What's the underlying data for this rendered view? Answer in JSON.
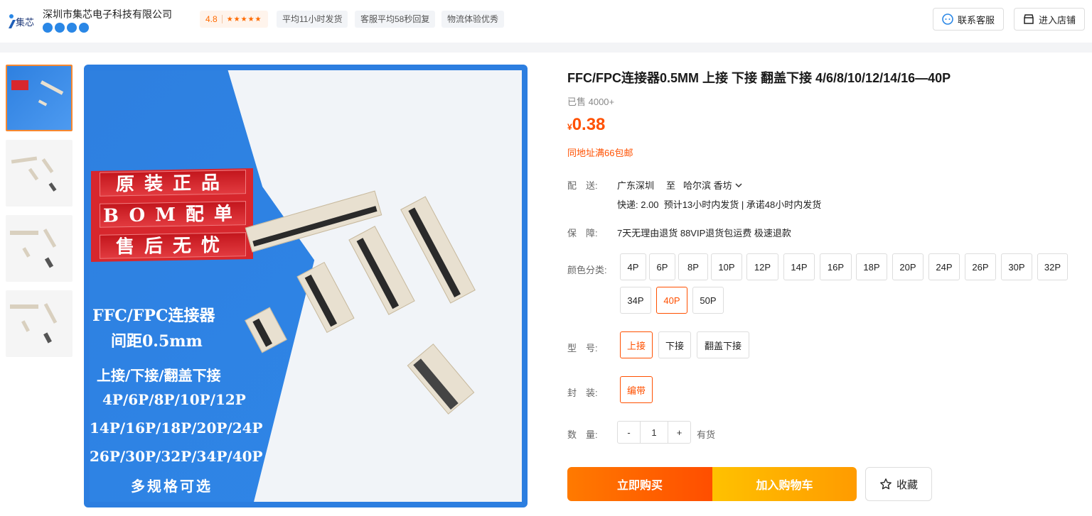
{
  "header": {
    "shop_name": "深圳市集芯电子科技有限公司",
    "logo_text": "集芯",
    "score": "4.8",
    "stars": "★★★★★",
    "tags": [
      "平均11小时发货",
      "客服平均58秒回复",
      "物流体验优秀"
    ],
    "contact_btn": "联系客服",
    "enter_shop_btn": "进入店铺",
    "accent_color": "#ff5000"
  },
  "gallery": {
    "thumb_count": 4,
    "main_image": {
      "red_lines": [
        "原装正品",
        "BOM配单",
        "售后无忧"
      ],
      "line1": "FFC/FPC连接器",
      "line2": "间距0.5mm",
      "line3": "上接/下接/翻盖下接",
      "line4": "4P/6P/8P/10P/12P",
      "line5": "14P/16P/18P/20P/24P",
      "line6": "26P/30P/32P/34P/40P",
      "line7": "多规格可选"
    }
  },
  "product": {
    "title": "FFC/FPC连接器0.5MM 上接 下接 翻盖下接 4/6/8/10/12/14/16—40P",
    "sold": "已售 4000+",
    "currency": "¥",
    "price": "0.38",
    "free_ship": "同地址满66包邮",
    "shipping": {
      "label": "配　送:",
      "from": "广东深圳",
      "to_word": "至",
      "to": "哈尔滨 香坊",
      "detail": "快递: 2.00  预计13小时内发货 | 承诺48小时内发货"
    },
    "guarantee": {
      "label": "保　障:",
      "value": "7天无理由退货 88VIP退货包运费 极速退款"
    },
    "color": {
      "label": "颜色分类:",
      "options": [
        "4P",
        "6P",
        "8P",
        "10P",
        "12P",
        "14P",
        "16P",
        "18P",
        "20P",
        "24P",
        "26P",
        "30P",
        "32P",
        "34P",
        "40P",
        "50P"
      ],
      "selected": "40P"
    },
    "model": {
      "label": "型　号:",
      "options": [
        "上接",
        "下接",
        "翻盖下接"
      ],
      "selected": "上接"
    },
    "package": {
      "label": "封　装:",
      "options": [
        "编带"
      ],
      "selected": "编带"
    },
    "quantity": {
      "label": "数　量:",
      "minus": "-",
      "value": "1",
      "plus": "+",
      "stock": "有货"
    },
    "buy_now": "立即购买",
    "add_cart": "加入购物车",
    "favorite": "收藏"
  }
}
